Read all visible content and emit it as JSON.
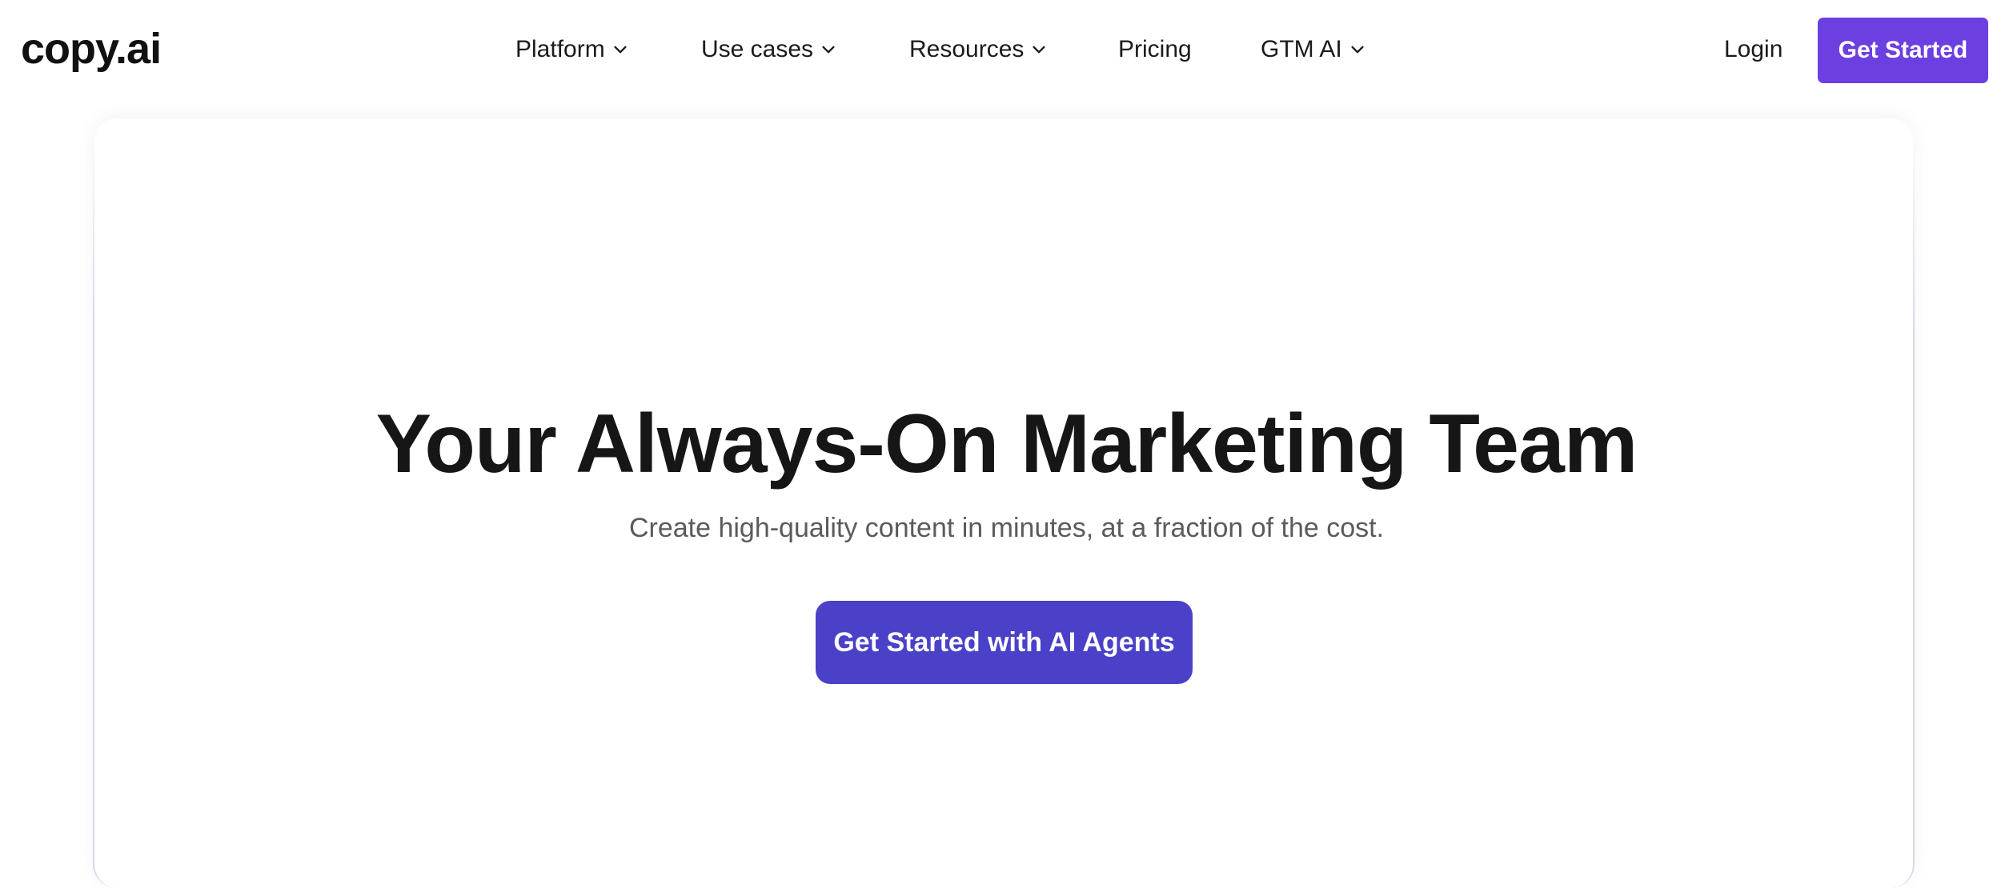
{
  "brand": {
    "logo_text": "copy.ai",
    "accent_color": "#6c3fe0",
    "cta_color": "#4a41c8"
  },
  "nav": {
    "items": [
      {
        "label": "Platform",
        "has_dropdown": true
      },
      {
        "label": "Use cases",
        "has_dropdown": true
      },
      {
        "label": "Resources",
        "has_dropdown": true
      },
      {
        "label": "Pricing",
        "has_dropdown": false
      },
      {
        "label": "GTM AI",
        "has_dropdown": true
      }
    ],
    "dropdown_icon": "chevron-down-icon"
  },
  "header_actions": {
    "login_label": "Login",
    "get_started_label": "Get Started"
  },
  "hero": {
    "title": "Your Always-On Marketing Team",
    "subtitle": "Create high-quality content in minutes, at a fraction of the cost.",
    "cta_label": "Get Started with AI Agents"
  }
}
